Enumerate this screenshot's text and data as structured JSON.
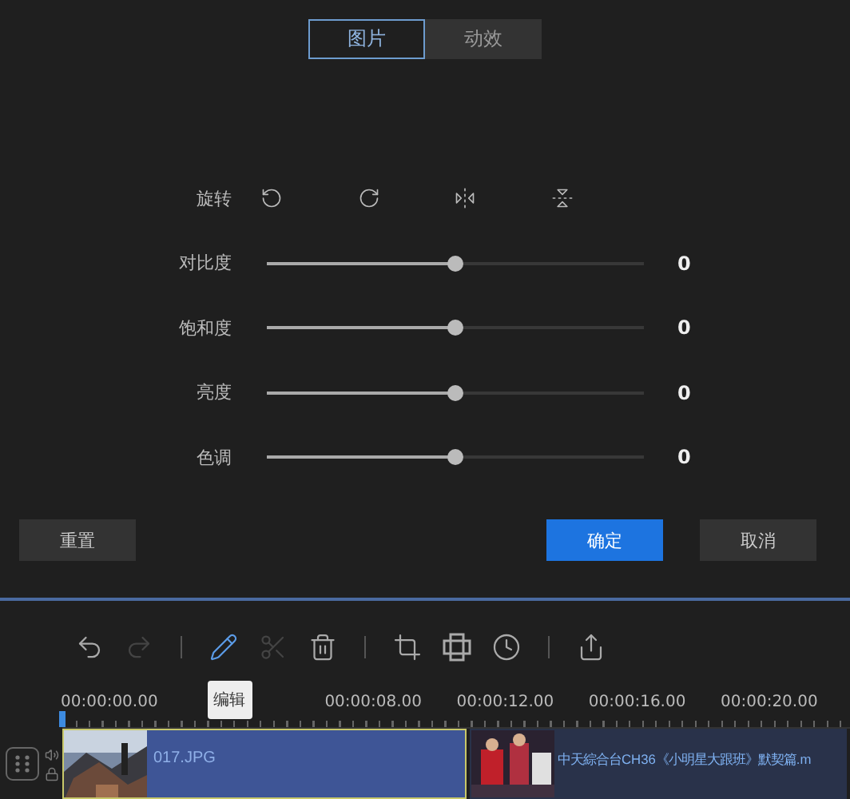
{
  "tabs": [
    {
      "label": "图片",
      "selected": true
    },
    {
      "label": "动效",
      "selected": false
    }
  ],
  "rotation": {
    "label": "旋转",
    "actions": [
      {
        "kind": "rotate-left"
      },
      {
        "kind": "rotate-right"
      },
      {
        "kind": "flip-horizontal"
      },
      {
        "kind": "flip-vertical"
      }
    ]
  },
  "adjustments": [
    {
      "label": "对比度",
      "level": 0.5,
      "reading": "0"
    },
    {
      "label": "饱和度",
      "level": 0.5,
      "reading": "0"
    },
    {
      "label": "亮度",
      "level": 0.5,
      "reading": "0"
    },
    {
      "label": "色调",
      "level": 0.5,
      "reading": "0"
    }
  ],
  "buttons": [
    {
      "label": "重置",
      "kind": "secondary"
    },
    {
      "label": "确定",
      "kind": "primary"
    },
    {
      "label": "取消",
      "kind": "secondary"
    }
  ],
  "toolbar": [
    [
      {
        "kind": "undo",
        "disabled": false,
        "selected": false
      },
      {
        "kind": "redo",
        "disabled": true,
        "selected": false
      }
    ],
    [
      {
        "kind": "edit",
        "disabled": false,
        "selected": true
      },
      {
        "kind": "cut",
        "disabled": true,
        "selected": false
      },
      {
        "kind": "delete",
        "disabled": false,
        "selected": false
      }
    ],
    [
      {
        "kind": "crop",
        "disabled": false,
        "selected": false
      },
      {
        "kind": "mosaic",
        "disabled": false,
        "selected": false
      },
      {
        "kind": "speed",
        "disabled": false,
        "selected": false
      }
    ],
    [
      {
        "kind": "export",
        "disabled": false,
        "selected": false
      }
    ]
  ],
  "tooltip": "编辑",
  "ruler": {
    "ticks": [
      {
        "label": "00:00:00.00",
        "covered": false
      },
      {
        "covered": true
      },
      {
        "label": "00:00:08.00",
        "covered": false
      },
      {
        "label": "00:00:12.00",
        "covered": false
      },
      {
        "label": "00:00:16.00",
        "covered": false
      },
      {
        "label": "00:00:20.00",
        "covered": false
      }
    ]
  },
  "clips": [
    {
      "name": "017.JPG",
      "selected": true
    },
    {
      "name": "中天綜合台CH36《小明星大跟班》默契篇.m",
      "selected": false
    }
  ]
}
